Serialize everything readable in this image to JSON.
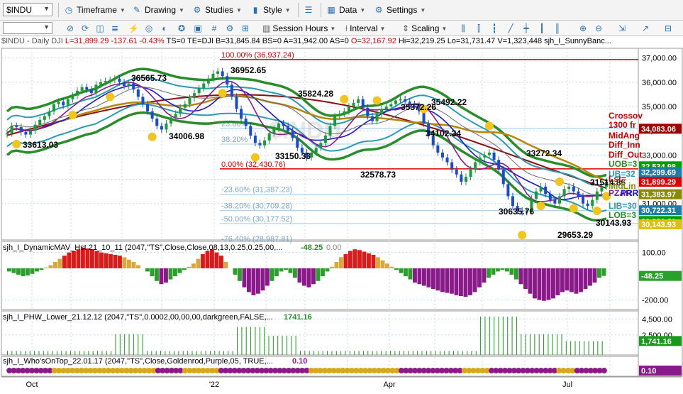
{
  "toolbar1": {
    "symbol": "$INDU",
    "timeframe": "Timeframe",
    "drawing": "Drawing",
    "studies": "Studies",
    "style": "Style",
    "data": "Data",
    "settings": "Settings"
  },
  "toolbar2": {
    "session_hours": "Session Hours",
    "interval": "Interval",
    "scaling": "Scaling"
  },
  "info": {
    "symbol": "$INDU - Daily",
    "exchange": "DJI",
    "last": "L=31,899.29",
    "change": "-137.61",
    "pct": "-0.43%",
    "ts": "TS=0",
    "te": "TE=DJI",
    "bid": "B=31,845.84",
    "bs": "BS=0",
    "ask": "A=31,942.00",
    "as": "AS=0",
    "open": "O=32,167.92",
    "hi": "Hi=32,219.25",
    "lo": "Lo=31,731.47",
    "vol": "V=1,323,448",
    "study": "sjh_I_SunnyBanc..."
  },
  "chart_data": [
    {
      "type": "line",
      "title": "$INDU - Daily",
      "x_ticks": [
        "Oct",
        "'22",
        "Apr",
        "Jul"
      ],
      "y_ticks": [
        "37,000.00",
        "36,000.00",
        "35,000.00",
        "34,000.00",
        "33,000.00",
        "32,000.00",
        "31,000.00"
      ],
      "ylim": [
        29500,
        37400
      ],
      "close": [
        33900,
        34200,
        34150,
        33950,
        33843,
        34000,
        34250,
        34450,
        34600,
        34800,
        35100,
        35200,
        35050,
        35300,
        35450,
        35650,
        35800,
        35700,
        35550,
        35900,
        36000,
        36050,
        36100,
        36150,
        36000,
        35850,
        35950,
        35700,
        35400,
        35100,
        34800,
        34500,
        34200,
        34050,
        34300,
        34550,
        34700,
        34950,
        35100,
        35350,
        35550,
        35750,
        35950,
        36150,
        36350,
        36450,
        36250,
        35900,
        35400,
        34900,
        34500,
        34200,
        33800,
        33500,
        33400,
        33600,
        33900,
        34100,
        34300,
        34200,
        34000,
        33700,
        33300,
        33100,
        32900,
        33100,
        33300,
        33500,
        33800,
        34200,
        34600,
        34700,
        34800,
        35000,
        35150,
        35300,
        34950,
        34600,
        34400,
        34700,
        34900,
        35000,
        35100,
        35250,
        35300,
        35200,
        35100,
        35050,
        34800,
        34300,
        33800,
        33400,
        33100,
        32900,
        32700,
        32400,
        32200,
        31900,
        32100,
        32400,
        32700,
        32900,
        33000,
        33100,
        32800,
        32400,
        31800,
        31300,
        30900,
        30700,
        30650,
        30700,
        31200,
        31500,
        31700,
        31400,
        31150,
        31000,
        31300,
        31600,
        31700,
        31500,
        31300,
        31000,
        30900,
        31150,
        31500,
        31700,
        31899
      ],
      "levels": {
        "fib_100": "100.00% (36,937.24)",
        "fib_0": "0.00% (32,430.76)",
        "fib_236": "23.60%",
        "fib_382": "38.20%",
        "fib_neg236": "-23.60% (31,387.23)",
        "fib_neg382": "-38.20% (30,709.28)",
        "fib_neg50": "-50.00% (30,177.52)",
        "fib_neg76": "-76.40% (28,987.81)"
      },
      "fib_levels_values": [
        36937.24,
        32430.76,
        31387.23,
        30709.28,
        30177.52
      ],
      "annotations": [
        "36565.73",
        "36952.65",
        "35824.28",
        "35372.26",
        "35492.22",
        "33613.03",
        "34006.98",
        "33150.33",
        "32578.73",
        "34102.34",
        "33272.34",
        "30635.76",
        "29653.29",
        "30143.93",
        "31514.86"
      ],
      "right_labels": {
        "crossover": "Crossov",
        "r1300": "1300 fr",
        "midang": "MidAng",
        "diff_in": "Diff_Inn",
        "diff_out": "Diff_Out",
        "uob": "UOB=3",
        "ub": "UB=32",
        "lst": "Lst=",
        "midlin": "MidLin",
        "pzar": "PZAR",
        "prr": "PRR",
        "lib": "LIB=30",
        "lob": "LOB=3"
      },
      "price_labels": [
        {
          "text": "34,083.06",
          "color": "#a00000",
          "value": 34083.06
        },
        {
          "text": "32,534.98",
          "color": "#00a000",
          "value": 32534.98
        },
        {
          "text": "32,299.69",
          "color": "#1a7ea8",
          "value": 32299.69
        },
        {
          "text": "31,899.29",
          "color": "#e00000",
          "value": 31899.29
        },
        {
          "text": "31,383.97",
          "color": "#8a8a00",
          "value": 31383.97
        },
        {
          "text": "30,722.31",
          "color": "#1a7ea8",
          "value": 30722.31
        },
        {
          "text": "30,281.21",
          "color": "#00a000",
          "value": 30281.21
        },
        {
          "text": "30,143.93",
          "color": "#e0c000",
          "value": 30143.93
        }
      ]
    },
    {
      "type": "bar",
      "title": "sjh_I_DynamicMAV_Hst 21_10_11 (2047,\"TS\",Close,Close,08,13,0.25,0.25,00,...",
      "last_value": "-48.25",
      "second_value": "0.00",
      "y_ticks": [
        "100.00",
        "-200.00"
      ],
      "price_label": "-48.25",
      "values": [
        -20,
        -30,
        -40,
        -50,
        -45,
        -35,
        -20,
        -10,
        5,
        20,
        40,
        60,
        80,
        100,
        110,
        120,
        130,
        125,
        120,
        110,
        100,
        95,
        90,
        85,
        80,
        70,
        55,
        40,
        20,
        0,
        -20,
        -50,
        -80,
        -100,
        -90,
        -70,
        -50,
        -30,
        -10,
        10,
        30,
        60,
        90,
        110,
        120,
        100,
        80,
        40,
        0,
        -40,
        -80,
        -120,
        -150,
        -170,
        -160,
        -140,
        -110,
        -80,
        -50,
        -20,
        -10,
        -30,
        -60,
        -90,
        -110,
        -120,
        -100,
        -80,
        -50,
        -20,
        10,
        40,
        70,
        90,
        110,
        120,
        115,
        105,
        95,
        85,
        70,
        50,
        30,
        10,
        -10,
        -30,
        -50,
        -70,
        -90,
        -100,
        -110,
        -120,
        -130,
        -140,
        -150,
        -155,
        -160,
        -170,
        -175,
        -180,
        -170,
        -150,
        -120,
        -90,
        -60,
        -40,
        -20,
        -10,
        -20,
        -40,
        -70,
        -100,
        -130,
        -160,
        -190,
        -200,
        -205,
        -200,
        -190,
        -170,
        -150,
        -140,
        -150,
        -160,
        -150,
        -130,
        -110,
        -90,
        -60,
        -48
      ]
    },
    {
      "type": "bar",
      "title": "sjh_I_PHW_Lower_21.12.12 (2047,\"TS\",0.0002,00,00,00,darkgreen,FALSE,...",
      "last_value": "1741.16",
      "y_ticks": [
        "4,500.00",
        "2,500.00"
      ],
      "price_label": "1,741.16",
      "values": [
        500,
        500,
        500,
        500,
        500,
        500,
        500,
        500,
        500,
        500,
        500,
        500,
        500,
        500,
        500,
        500,
        500,
        500,
        500,
        500,
        500,
        500,
        500,
        500,
        2600,
        2600,
        2600,
        2600,
        2600,
        2600,
        2600,
        500,
        500,
        500,
        500,
        500,
        500,
        500,
        500,
        500,
        500,
        500,
        500,
        500,
        500,
        500,
        500,
        500,
        500,
        500,
        500,
        3500,
        3500,
        3500,
        3500,
        3500,
        3500,
        3500,
        2400,
        2400,
        2400,
        2400,
        2400,
        2400,
        2400,
        500,
        500,
        500,
        500,
        500,
        500,
        500,
        500,
        500,
        500,
        500,
        500,
        500,
        500,
        500,
        500,
        500,
        500,
        500,
        500,
        500,
        500,
        500,
        500,
        500,
        500,
        500,
        500,
        500,
        500,
        500,
        500,
        500,
        500,
        500,
        500,
        500,
        500,
        500,
        500,
        4800,
        4800,
        4800,
        4800,
        4800,
        4800,
        4800,
        4800,
        4800,
        2600,
        2600,
        2600,
        2600,
        2600,
        2600,
        2600,
        2600,
        2600,
        2600,
        1741,
        1741,
        1741,
        1741,
        1741,
        1741,
        1741,
        1741,
        1741
      ]
    },
    {
      "type": "bar",
      "title": "sjh_I_Who'sOnTop_22.01.17 (2047,\"TS\",Close,Goldenrod,Purple,05, TRUE,...",
      "last_value": "0.10",
      "price_label": "0.10",
      "values": [
        -1,
        -1,
        -1,
        -1,
        -1,
        -1,
        -1,
        -1,
        -1,
        -1,
        1,
        1,
        1,
        1,
        1,
        1,
        1,
        1,
        1,
        1,
        1,
        1,
        1,
        1,
        1,
        1,
        1,
        1,
        1,
        1,
        1,
        1,
        1,
        -1,
        -1,
        -1,
        -1,
        -1,
        -1,
        1,
        1,
        1,
        1,
        1,
        1,
        1,
        1,
        -1,
        -1,
        -1,
        -1,
        -1,
        -1,
        -1,
        -1,
        -1,
        -1,
        -1,
        -1,
        -1,
        -1,
        -1,
        -1,
        -1,
        -1,
        -1,
        -1,
        1,
        1,
        1,
        1,
        1,
        1,
        1,
        1,
        1,
        1,
        1,
        1,
        1,
        1,
        1,
        1,
        1,
        1,
        1,
        1,
        -1,
        -1,
        -1,
        -1,
        -1,
        -1,
        -1,
        -1,
        -1,
        -1,
        -1,
        -1,
        -1,
        -1,
        1,
        1,
        1,
        1,
        1,
        1,
        -1,
        -1,
        -1,
        -1,
        -1,
        -1,
        -1,
        -1,
        -1,
        -1,
        -1,
        -1,
        -1,
        -1,
        -1,
        1,
        1,
        1,
        1,
        -1,
        -1,
        -1,
        -1,
        -1,
        -1,
        -1
      ]
    }
  ]
}
